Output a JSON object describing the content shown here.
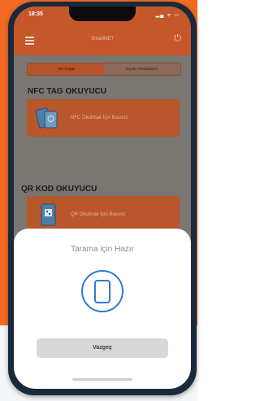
{
  "status_bar": {
    "time": "18:35",
    "icons": "▂▄ ᯤ ▭"
  },
  "header": {
    "title": "SmartNET"
  },
  "tabs": [
    {
      "label": "Yan Soyak"
    },
    {
      "label": "Kayıtlı Arkadaşlarım"
    }
  ],
  "nfc": {
    "section_title": "NFC TAG OKUYUCU",
    "button_label": "NFC Okutmak İçin Basınız"
  },
  "qr": {
    "section_title": "QR KOD OKUYUCU",
    "button_label": "QR Okutmak İçin Basınız"
  },
  "sheet": {
    "title": "Tarama için Hazır",
    "cancel_label": "Vazgeç"
  },
  "colors": {
    "brand_orange": "#f36a23",
    "accent": "#2e7bd6"
  }
}
